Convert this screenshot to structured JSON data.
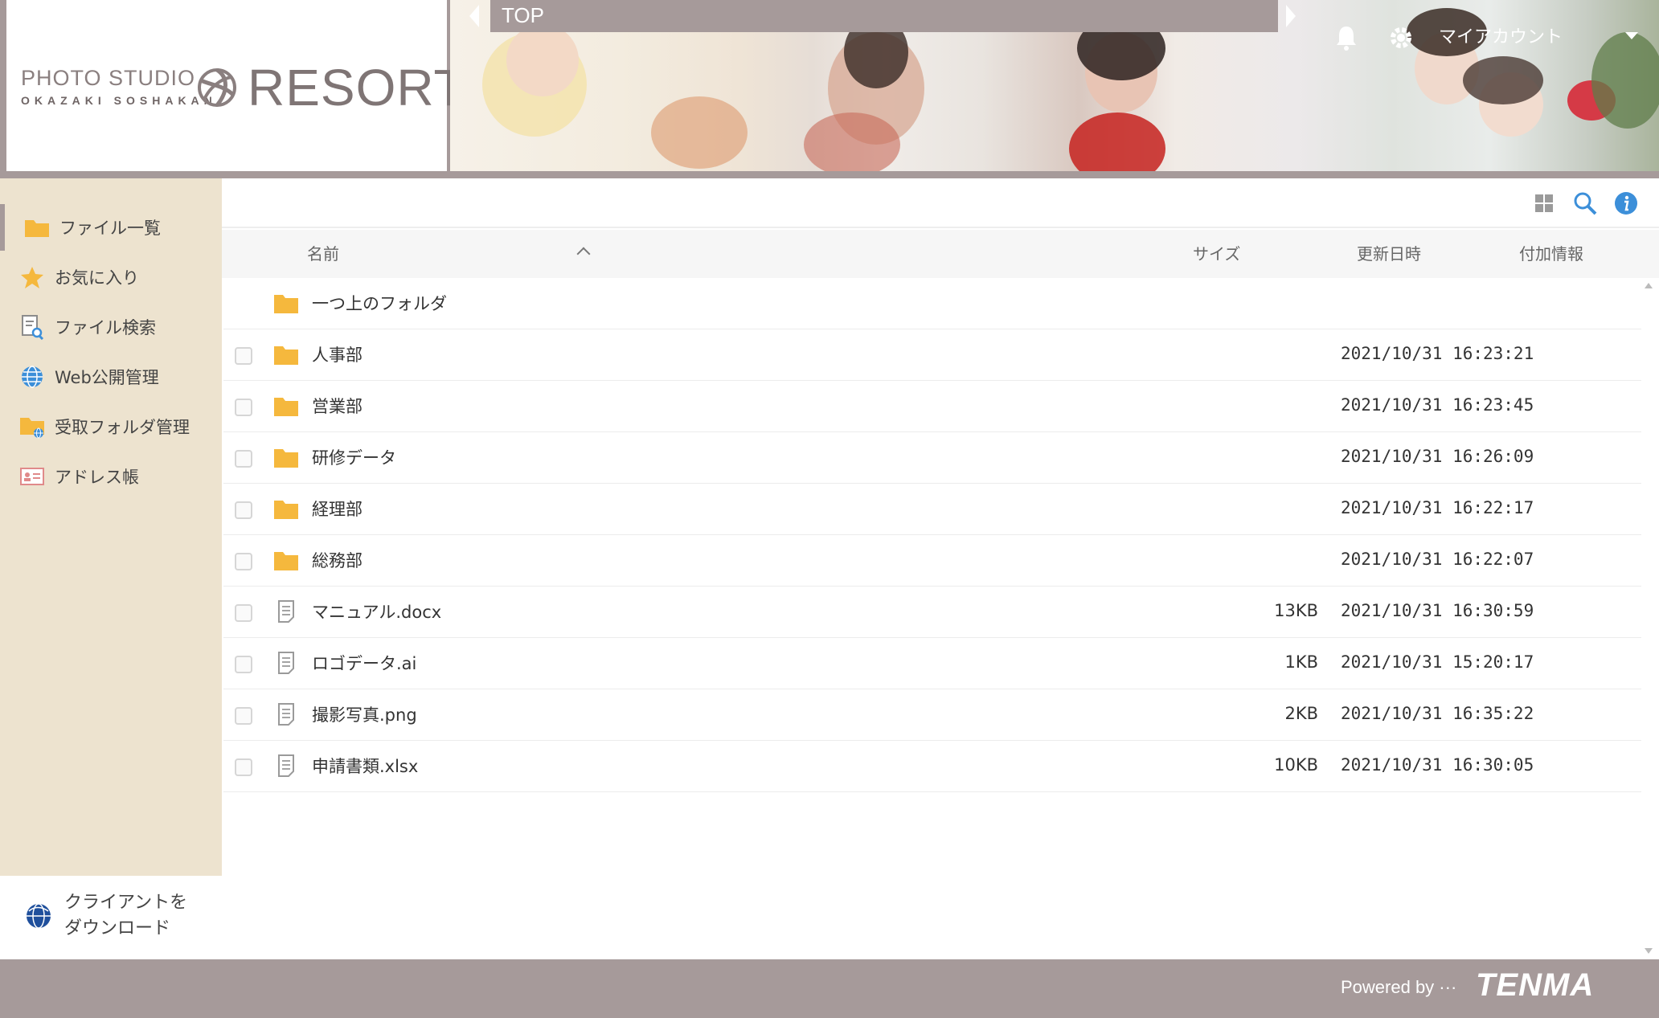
{
  "header": {
    "logo": {
      "studio": "PHOTO STUDIO",
      "sub": "OKAZAKI SOSHAKAN",
      "name": "RESORTE"
    },
    "tab_label": "TOP",
    "account_label": "マイアカウント"
  },
  "sidebar": {
    "items": [
      {
        "label": "ファイル一覧",
        "icon": "folder-icon"
      },
      {
        "label": "お気に入り",
        "icon": "star-icon"
      },
      {
        "label": "ファイル検索",
        "icon": "file-search-icon"
      },
      {
        "label": "Web公開管理",
        "icon": "globe-icon"
      },
      {
        "label": "受取フォルダ管理",
        "icon": "folder-globe-icon"
      },
      {
        "label": "アドレス帳",
        "icon": "address-card-icon"
      }
    ],
    "download_line1": "クライアントを",
    "download_line2": "ダウンロード"
  },
  "table": {
    "columns": {
      "name": "名前",
      "size": "サイズ",
      "updated": "更新日時",
      "extra": "付加情報"
    },
    "parent_folder": "一つ上のフォルダ",
    "rows": [
      {
        "name": "人事部",
        "size": "",
        "date": "2021/10/31 16:23:21",
        "type": "folder"
      },
      {
        "name": "営業部",
        "size": "",
        "date": "2021/10/31 16:23:45",
        "type": "folder"
      },
      {
        "name": "研修データ",
        "size": "",
        "date": "2021/10/31 16:26:09",
        "type": "folder"
      },
      {
        "name": "経理部",
        "size": "",
        "date": "2021/10/31 16:22:17",
        "type": "folder"
      },
      {
        "name": "総務部",
        "size": "",
        "date": "2021/10/31 16:22:07",
        "type": "folder"
      },
      {
        "name": "マニュアル.docx",
        "size": "13KB",
        "date": "2021/10/31 16:30:59",
        "type": "file"
      },
      {
        "name": "ロゴデータ.ai",
        "size": "1KB",
        "date": "2021/10/31 15:20:17",
        "type": "file"
      },
      {
        "name": "撮影写真.png",
        "size": "2KB",
        "date": "2021/10/31 16:35:22",
        "type": "file"
      },
      {
        "name": "申請書類.xlsx",
        "size": "10KB",
        "date": "2021/10/31 16:30:05",
        "type": "file"
      }
    ]
  },
  "footer": {
    "powered_by": "Powered by ···",
    "brand": "TENMA"
  },
  "colors": {
    "chrome": "#a69a9a",
    "sidebar_bg": "#ede3cf",
    "folder": "#f5b83d",
    "accent_blue": "#3c8fd9"
  }
}
